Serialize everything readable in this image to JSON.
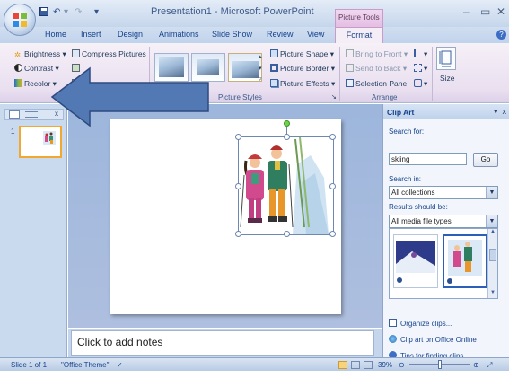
{
  "titlebar": {
    "title": "Presentation1 - Microsoft PowerPoint",
    "contextual_tab_group": "Picture Tools",
    "minimize": "–",
    "maximize": "▭",
    "close": "✕"
  },
  "tabs": [
    "Home",
    "Insert",
    "Design",
    "Animations",
    "Slide Show",
    "Review",
    "View"
  ],
  "active_tab": "Format",
  "ribbon": {
    "adjust": {
      "brightness": "Brightness",
      "contrast": "Contrast",
      "recolor": "Recolor",
      "compress": "Compress Pictures"
    },
    "picture_styles": {
      "label": "Picture Styles",
      "shape": "Picture Shape",
      "border": "Picture Border",
      "effects": "Picture Effects"
    },
    "arrange": {
      "label": "Arrange",
      "bring_to_front": "Bring to Front",
      "send_to_back": "Send to Back",
      "selection_pane": "Selection Pane"
    },
    "size": {
      "label": "Size"
    }
  },
  "left_pane": {
    "slide_number": "1"
  },
  "notes": {
    "placeholder": "Click to add notes"
  },
  "clipart": {
    "title": "Clip Art",
    "search_for_label": "Search for:",
    "search_value": "skiing",
    "go_label": "Go",
    "search_in_label": "Search in:",
    "search_in_value": "All collections",
    "results_label": "Results should be:",
    "results_value": "All media file types",
    "links": {
      "organize": "Organize clips...",
      "online": "Clip art on Office Online",
      "tips": "Tips for finding clips"
    }
  },
  "statusbar": {
    "slide_info": "Slide 1 of 1",
    "theme": "\"Office Theme\"",
    "zoom": "39%"
  },
  "colors": {
    "ribbon_accent": "#e5bee4",
    "chrome_blue": "#c5d6ec",
    "arrow_blue": "#5279b3"
  }
}
